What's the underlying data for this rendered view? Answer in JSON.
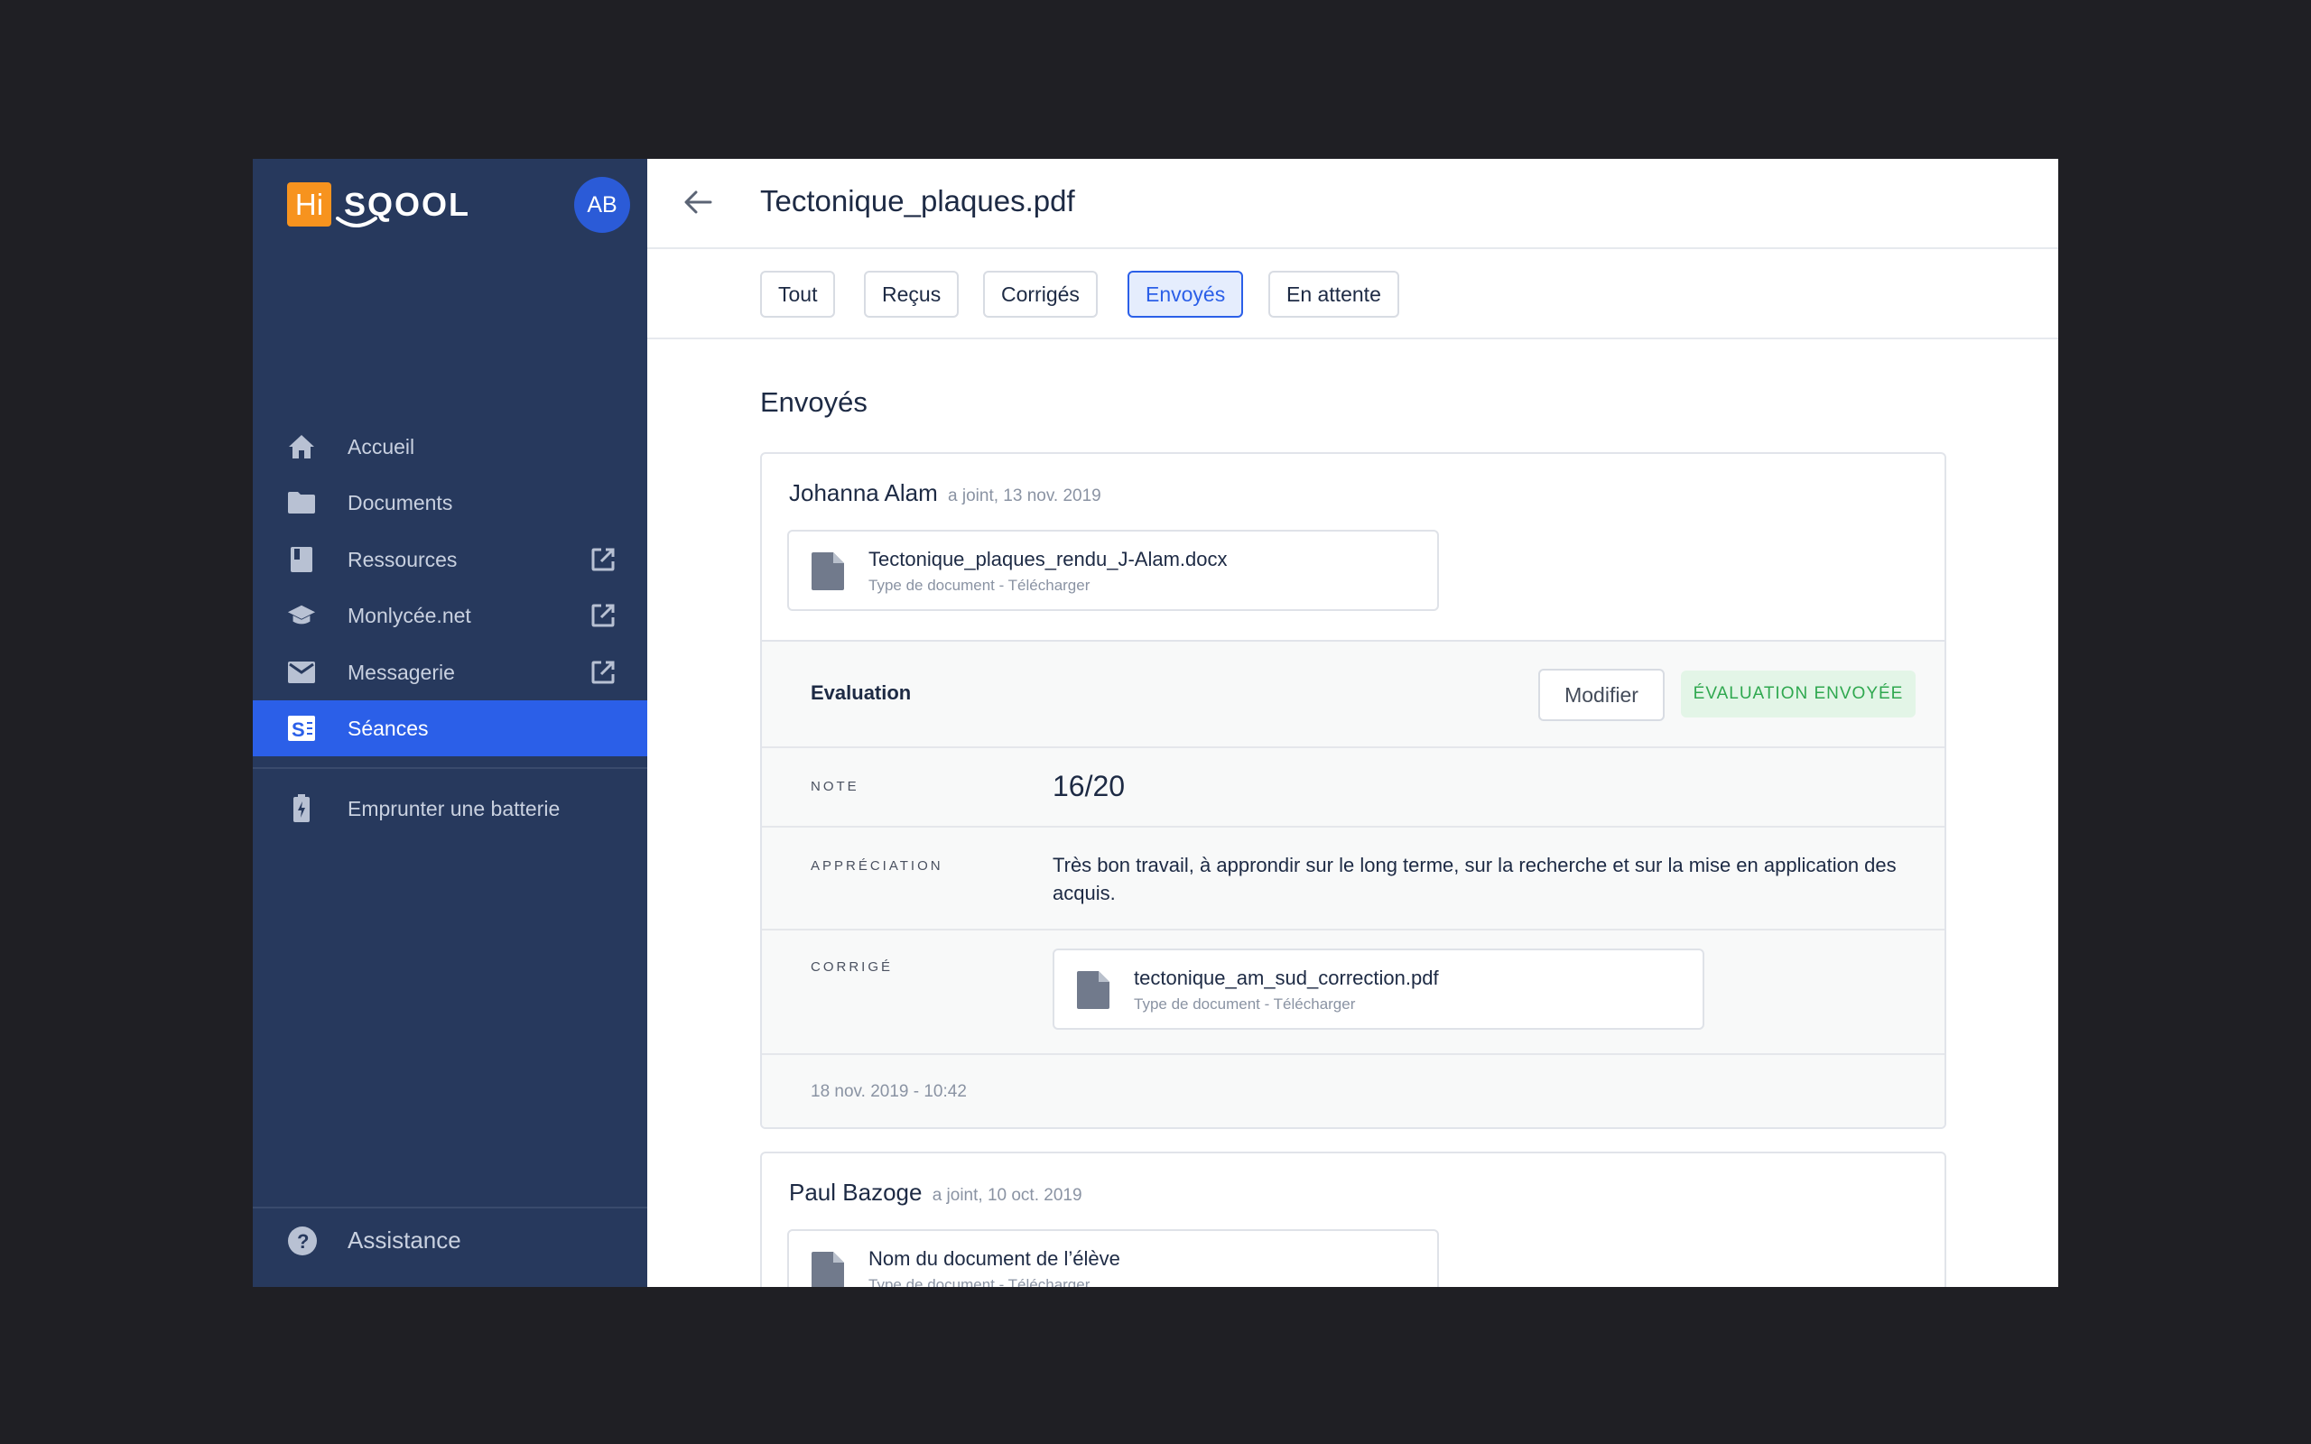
{
  "sidebar": {
    "logo_mark": "Hi",
    "logo_text": "SQOOL",
    "avatar": "AB",
    "items": [
      {
        "label": "Accueil"
      },
      {
        "label": "Documents"
      },
      {
        "label": "Ressources"
      },
      {
        "label": "Monlycée.net"
      },
      {
        "label": "Messagerie"
      },
      {
        "label": "Séances"
      },
      {
        "label": "Emprunter une batterie"
      }
    ],
    "assistance": "Assistance",
    "active_color": "#2b5fe8"
  },
  "header": {
    "title": "Tectonique_plaques.pdf"
  },
  "tabs": [
    {
      "label": "Tout"
    },
    {
      "label": "Reçus"
    },
    {
      "label": "Corrigés"
    },
    {
      "label": "Envoyés",
      "active": true
    },
    {
      "label": "En attente"
    }
  ],
  "section": {
    "title": "Envoyés"
  },
  "submissions": [
    {
      "student": "Johanna Alam",
      "meta": "a joint, 13 nov. 2019",
      "file": {
        "name": "Tectonique_plaques_rendu_J-Alam.docx",
        "sub": "Type de document - Télécharger"
      },
      "evaluation": {
        "title": "Evaluation",
        "modify_label": "Modifier",
        "status": "ÉVALUATION ENVOYÉE",
        "note_label": "NOTE",
        "note": "16/20",
        "appreciation_label": "APPRÉCIATION",
        "appreciation": "Très bon travail, à approndir sur le long terme, sur la recherche et sur la mise en application des acquis.",
        "corrige_label": "CORRIGÉ",
        "corrige_file": {
          "name": "tectonique_am_sud_correction.pdf",
          "sub": "Type de document - Télécharger"
        },
        "date": "18 nov. 2019 - 10:42"
      }
    },
    {
      "student": "Paul Bazoge",
      "meta": "a joint, 10 oct. 2019",
      "file": {
        "name": "Nom du document de l’élève",
        "sub": "Type de document - Télécharger"
      }
    }
  ]
}
